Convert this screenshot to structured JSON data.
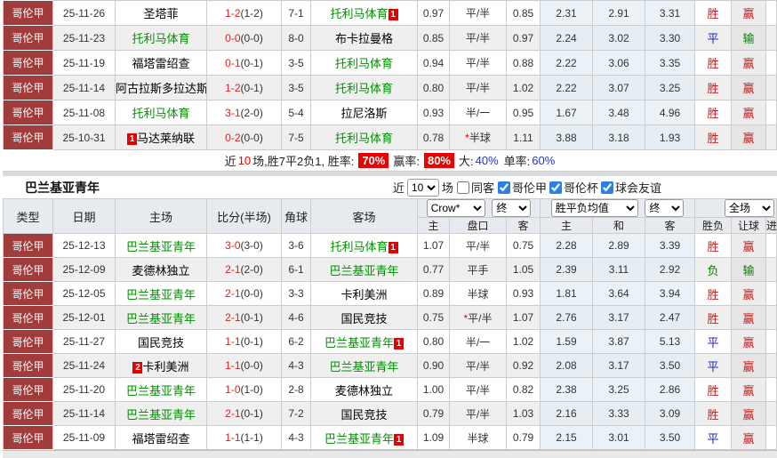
{
  "colors": {
    "league_bg": "#a03c3c",
    "win": "#c41e1e",
    "draw": "#2222cc",
    "lose": "#068206",
    "focus_team": "#009000",
    "rate_box_bg": "#ee0000",
    "badge_bg": "#e60000"
  },
  "table1": {
    "rows": [
      {
        "league": "哥伦甲",
        "date": "25-11-26",
        "home_pre": "",
        "home": "圣塔菲",
        "home_post": "",
        "ft": "1-2",
        "ht": "(1-2)",
        "corner": "7-1",
        "away_pre": "",
        "away": "托利马体育",
        "away_post": "1",
        "oh": "0.97",
        "hstar": "",
        "hc": "平/半",
        "oa": "0.85",
        "ah": "2.31",
        "ad": "2.91",
        "aa": "3.31",
        "res": "胜",
        "lres": "赢"
      },
      {
        "league": "哥伦甲",
        "date": "25-11-23",
        "home_pre": "",
        "home": "托利马体育",
        "home_post": "",
        "ft": "0-0",
        "ht": "(0-0)",
        "corner": "8-0",
        "away_pre": "",
        "away": "布卡拉曼格",
        "away_post": "",
        "oh": "0.85",
        "hstar": "",
        "hc": "平/半",
        "oa": "0.97",
        "ah": "2.24",
        "ad": "3.02",
        "aa": "3.30",
        "res": "平",
        "lres": "输"
      },
      {
        "league": "哥伦甲",
        "date": "25-11-19",
        "home_pre": "",
        "home": "福塔雷绍查",
        "home_post": "",
        "ft": "0-1",
        "ht": "(0-1)",
        "corner": "3-5",
        "away_pre": "",
        "away": "托利马体育",
        "away_post": "",
        "oh": "0.94",
        "hstar": "",
        "hc": "平/半",
        "oa": "0.88",
        "ah": "2.22",
        "ad": "3.06",
        "aa": "3.35",
        "res": "胜",
        "lres": "赢"
      },
      {
        "league": "哥伦甲",
        "date": "25-11-14",
        "home_pre": "",
        "home": "阿古拉斯多拉达斯",
        "home_post": "",
        "ft": "1-2",
        "ht": "(0-1)",
        "corner": "3-5",
        "away_pre": "",
        "away": "托利马体育",
        "away_post": "",
        "oh": "0.80",
        "hstar": "",
        "hc": "平/半",
        "oa": "1.02",
        "ah": "2.22",
        "ad": "3.07",
        "aa": "3.25",
        "res": "胜",
        "lres": "赢"
      },
      {
        "league": "哥伦甲",
        "date": "25-11-08",
        "home_pre": "",
        "home": "托利马体育",
        "home_post": "",
        "ft": "3-1",
        "ht": "(2-0)",
        "corner": "5-4",
        "away_pre": "",
        "away": "拉尼洛斯",
        "away_post": "",
        "oh": "0.93",
        "hstar": "",
        "hc": "半/一",
        "oa": "0.95",
        "ah": "1.67",
        "ad": "3.48",
        "aa": "4.96",
        "res": "胜",
        "lres": "赢"
      },
      {
        "league": "哥伦甲",
        "date": "25-10-31",
        "home_pre": "1",
        "home": "马达莱纳联",
        "home_post": "",
        "ft": "0-2",
        "ht": "(0-0)",
        "corner": "7-5",
        "away_pre": "",
        "away": "托利马体育",
        "away_post": "",
        "oh": "0.78",
        "hstar": "*",
        "hc": "半球",
        "oa": "1.11",
        "ah": "3.88",
        "ad": "3.18",
        "aa": "1.93",
        "res": "胜",
        "lres": "赢"
      }
    ]
  },
  "summary": {
    "p1": "近",
    "n": "10",
    "p2": "场,胜7平2负1, 胜率:",
    "win_rate": "70%",
    "p3": "赢率:",
    "asian_rate": "80%",
    "p4": "大:",
    "big_rate": "40%",
    "p5": "单率:",
    "single_rate": "60%"
  },
  "section2": {
    "title": "巴兰基亚青年",
    "near_label": "近",
    "count": "10",
    "games_label": "场",
    "sameaway_label": "同客",
    "leagues": [
      {
        "label": "哥伦甲",
        "checked": "checked"
      },
      {
        "label": "哥伦杯",
        "checked": "checked"
      },
      {
        "label": "球会友谊",
        "checked": "checked"
      }
    ]
  },
  "table2": {
    "header": {
      "type": "类型",
      "date": "日期",
      "home": "主场",
      "score": "比分(半场)",
      "corner": "角球",
      "away": "客场",
      "sel_crow": "Crow*",
      "sel_end1": "终",
      "sel_avg": "胜平负均值",
      "sel_end2": "终",
      "sel_full": "全场",
      "sub_home": "主",
      "sub_handicap": "盘口",
      "sub_away": "客",
      "sub_avg_home": "主",
      "sub_avg_draw": "和",
      "sub_avg_away": "客",
      "sub_result": "胜负",
      "sub_letgoal": "让球",
      "sub_goal": "进球"
    },
    "rows": [
      {
        "league": "哥伦甲",
        "date": "25-12-13",
        "home_pre": "",
        "home": "巴兰基亚青年",
        "home_post": "",
        "ft": "3-0",
        "ht": "(3-0)",
        "corner": "3-6",
        "away_pre": "",
        "away": "托利马体育",
        "away_post": "1",
        "oh": "1.07",
        "hstar": "",
        "hc": "平/半",
        "oa": "0.75",
        "ah": "2.28",
        "ad": "2.89",
        "aa": "3.39",
        "res": "胜",
        "lres": "赢"
      },
      {
        "league": "哥伦甲",
        "date": "25-12-09",
        "home_pre": "",
        "home": "麦德林独立",
        "home_post": "",
        "ft": "2-1",
        "ht": "(2-0)",
        "corner": "6-1",
        "away_pre": "",
        "away": "巴兰基亚青年",
        "away_post": "",
        "oh": "0.77",
        "hstar": "",
        "hc": "平手",
        "oa": "1.05",
        "ah": "2.39",
        "ad": "3.11",
        "aa": "2.92",
        "res": "负",
        "lres": "输"
      },
      {
        "league": "哥伦甲",
        "date": "25-12-05",
        "home_pre": "",
        "home": "巴兰基亚青年",
        "home_post": "",
        "ft": "2-1",
        "ht": "(0-0)",
        "corner": "3-3",
        "away_pre": "",
        "away": "卡利美洲",
        "away_post": "",
        "oh": "0.89",
        "hstar": "",
        "hc": "半球",
        "oa": "0.93",
        "ah": "1.81",
        "ad": "3.64",
        "aa": "3.94",
        "res": "胜",
        "lres": "赢"
      },
      {
        "league": "哥伦甲",
        "date": "25-12-01",
        "home_pre": "",
        "home": "巴兰基亚青年",
        "home_post": "",
        "ft": "2-1",
        "ht": "(0-1)",
        "corner": "4-6",
        "away_pre": "",
        "away": "国民竞技",
        "away_post": "",
        "oh": "0.75",
        "hstar": "*",
        "hc": "平/半",
        "oa": "1.07",
        "ah": "2.76",
        "ad": "3.17",
        "aa": "2.47",
        "res": "胜",
        "lres": "赢"
      },
      {
        "league": "哥伦甲",
        "date": "25-11-27",
        "home_pre": "",
        "home": "国民竞技",
        "home_post": "",
        "ft": "1-1",
        "ht": "(0-1)",
        "corner": "6-2",
        "away_pre": "",
        "away": "巴兰基亚青年",
        "away_post": "1",
        "oh": "0.80",
        "hstar": "",
        "hc": "半/一",
        "oa": "1.02",
        "ah": "1.59",
        "ad": "3.87",
        "aa": "5.13",
        "res": "平",
        "lres": "赢"
      },
      {
        "league": "哥伦甲",
        "date": "25-11-24",
        "home_pre": "2",
        "home": "卡利美洲",
        "home_post": "",
        "ft": "1-1",
        "ht": "(0-0)",
        "corner": "4-3",
        "away_pre": "",
        "away": "巴兰基亚青年",
        "away_post": "",
        "oh": "0.90",
        "hstar": "",
        "hc": "平/半",
        "oa": "0.92",
        "ah": "2.08",
        "ad": "3.17",
        "aa": "3.50",
        "res": "平",
        "lres": "赢"
      },
      {
        "league": "哥伦甲",
        "date": "25-11-20",
        "home_pre": "",
        "home": "巴兰基亚青年",
        "home_post": "",
        "ft": "1-0",
        "ht": "(1-0)",
        "corner": "2-8",
        "away_pre": "",
        "away": "麦德林独立",
        "away_post": "",
        "oh": "1.00",
        "hstar": "",
        "hc": "平/半",
        "oa": "0.82",
        "ah": "2.38",
        "ad": "3.25",
        "aa": "2.86",
        "res": "胜",
        "lres": "赢"
      },
      {
        "league": "哥伦甲",
        "date": "25-11-14",
        "home_pre": "",
        "home": "巴兰基亚青年",
        "home_post": "",
        "ft": "2-1",
        "ht": "(0-1)",
        "corner": "7-2",
        "away_pre": "",
        "away": "国民竞技",
        "away_post": "",
        "oh": "0.79",
        "hstar": "",
        "hc": "平/半",
        "oa": "1.03",
        "ah": "2.16",
        "ad": "3.33",
        "aa": "3.09",
        "res": "胜",
        "lres": "赢"
      },
      {
        "league": "哥伦甲",
        "date": "25-11-09",
        "home_pre": "",
        "home": "福塔雷绍查",
        "home_post": "",
        "ft": "1-1",
        "ht": "(1-1)",
        "corner": "4-3",
        "away_pre": "",
        "away": "巴兰基亚青年",
        "away_post": "1",
        "oh": "1.09",
        "hstar": "",
        "hc": "半球",
        "oa": "0.79",
        "ah": "2.15",
        "ad": "3.01",
        "aa": "3.50",
        "res": "平",
        "lres": "赢"
      }
    ]
  }
}
